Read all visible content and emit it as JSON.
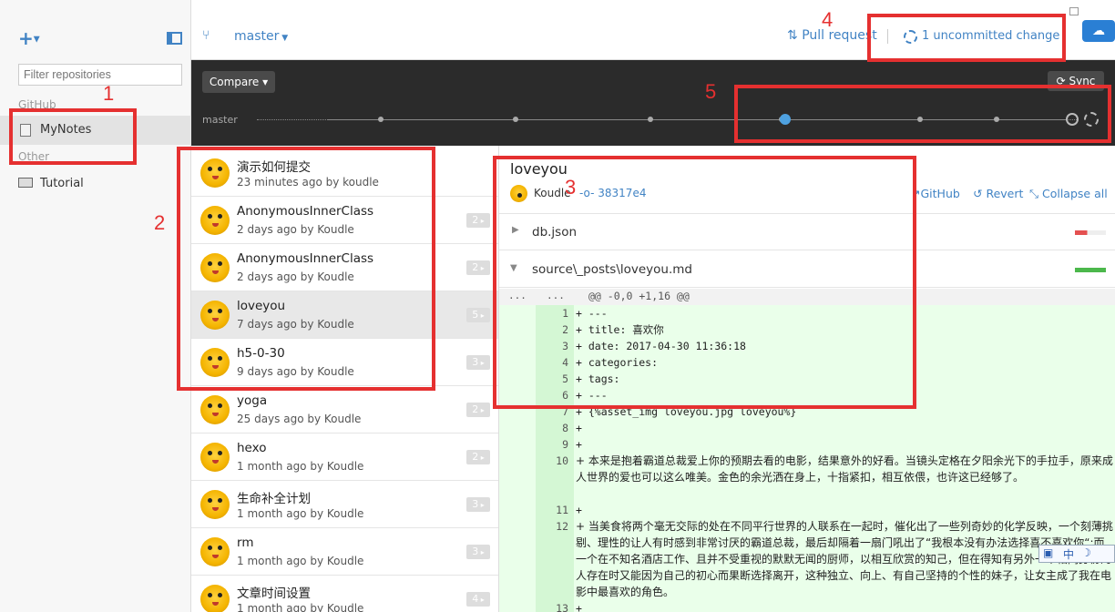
{
  "sidebar": {
    "add_label": "+",
    "filter_placeholder": "Filter repositories",
    "groups": [
      {
        "label": "GitHub"
      },
      {
        "label": "Other"
      }
    ],
    "repos": [
      {
        "label": "MyNotes"
      },
      {
        "label": "Tutorial"
      }
    ]
  },
  "topbar": {
    "branch": "master",
    "pull_request": "Pull request",
    "uncommitted": "1 uncommitted change"
  },
  "timeline": {
    "compare": "Compare",
    "sync": "Sync",
    "branch_label": "master"
  },
  "commits": [
    {
      "title": "演示如何提交",
      "meta": "23 minutes ago by koudle",
      "badge": ""
    },
    {
      "title": "AnonymousInnerClass",
      "meta": "2 days ago by Koudle",
      "badge": "2"
    },
    {
      "title": "AnonymousInnerClass",
      "meta": "2 days ago by Koudle",
      "badge": "2"
    },
    {
      "title": "loveyou",
      "meta": "7 days ago by Koudle",
      "badge": "5"
    },
    {
      "title": "h5-0-30",
      "meta": "9 days ago by Koudle",
      "badge": "3"
    },
    {
      "title": "yoga",
      "meta": "25 days ago by Koudle",
      "badge": "2"
    },
    {
      "title": "hexo",
      "meta": "1 month ago by Koudle",
      "badge": "2"
    },
    {
      "title": "生命补全计划",
      "meta": "1 month ago by Koudle",
      "badge": "3"
    },
    {
      "title": "rm",
      "meta": "1 month ago by Koudle",
      "badge": "3"
    },
    {
      "title": "文章时间设置",
      "meta": "1 month ago by Koudle",
      "badge": "4"
    }
  ],
  "detail": {
    "title": "loveyou",
    "author": "Koudle",
    "sha": "38317e4",
    "github": "GitHub",
    "revert": "Revert",
    "collapse": "Collapse all",
    "files": [
      {
        "name": "db.json"
      },
      {
        "name": "source\\_posts\\loveyou.md"
      }
    ],
    "hunk": {
      "old": "...",
      "new": "...",
      "header": "@@ -0,0 +1,16 @@"
    },
    "lines": [
      {
        "n": "1",
        "t": "+ ---"
      },
      {
        "n": "2",
        "t": "+ title: 喜欢你"
      },
      {
        "n": "3",
        "t": "+ date: 2017-04-30 11:36:18"
      },
      {
        "n": "4",
        "t": "+ categories:"
      },
      {
        "n": "5",
        "t": "+ tags:"
      },
      {
        "n": "6",
        "t": "+ ---"
      },
      {
        "n": "7",
        "t": "+ {%asset_img loveyou.jpg loveyou%}"
      },
      {
        "n": "8",
        "t": "+"
      },
      {
        "n": "9",
        "t": "+"
      }
    ],
    "para10": {
      "n": "10",
      "t": "+ 本来是抱着霸道总裁爱上你的预期去看的电影，结果意外的好看。当镜头定格在夕阳余光下的手拉手，原来成人世界的爱也可以这么唯美。金色的余光洒在身上，十指紧扣，相互依偎，也许这已经够了。"
    },
    "line11": {
      "n": "11",
      "t": "+"
    },
    "para12": {
      "n": "12",
      "t": "+ 当美食将两个毫无交际的处在不同平行世界的人联系在一起时，催化出了一些列奇妙的化学反映，一个刻薄挑剔、理性的让人有时感到非常讨厌的霸道总裁，最后却隔着一扇门吼出了“我根本没有办法选择喜不喜欢你“;而一个在不知名酒店工作、且并不受重视的默默无闻的厨师，以相互欣赏的知己，但在得知有另外一个相同身份的人存在时又能因为自己的初心而果断选择离开，这种独立、向上、有自己坚持的个性的妹子，让女主成了我在电影中最喜欢的角色。"
    },
    "line13": {
      "n": "13",
      "t": "+"
    }
  },
  "ime": {
    "label": "中"
  },
  "annotations": [
    "1",
    "2",
    "3",
    "4",
    "5"
  ]
}
